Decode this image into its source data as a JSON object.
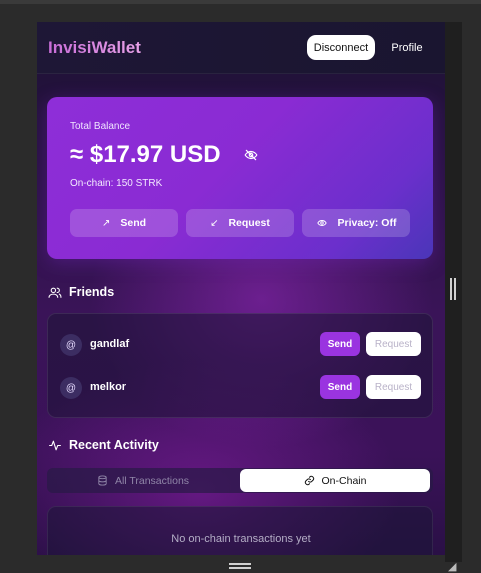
{
  "header": {
    "app_name": "InvisiWallet",
    "disconnect_label": "Disconnect",
    "profile_label": "Profile"
  },
  "balance": {
    "label": "Total Balance",
    "amount": "≈ $17.97 USD",
    "onchain": "On-chain: 150 STRK",
    "buttons": {
      "send": "Send",
      "request": "Request",
      "privacy": "Privacy: Off"
    }
  },
  "friends": {
    "title": "Friends",
    "items": [
      {
        "name": "gandlaf",
        "send": "Send",
        "request": "Request"
      },
      {
        "name": "melkor",
        "send": "Send",
        "request": "Request"
      }
    ]
  },
  "activity": {
    "title": "Recent Activity",
    "tabs": {
      "all": "All Transactions",
      "onchain": "On-Chain"
    },
    "empty": "No on-chain transactions yet"
  },
  "icons": {
    "send": "arrow-up-right-icon",
    "request": "arrow-down-left-icon",
    "privacy": "eye-icon",
    "hide_balance": "eye-off-icon",
    "friends": "users-icon",
    "activity": "activity-icon",
    "all_tx": "database-icon",
    "onchain": "link-icon"
  },
  "colors": {
    "accent": "#9a34e0",
    "card_start": "#8e2ed8",
    "card_end": "#4a36b8",
    "brand_text": "#c86dd7"
  }
}
